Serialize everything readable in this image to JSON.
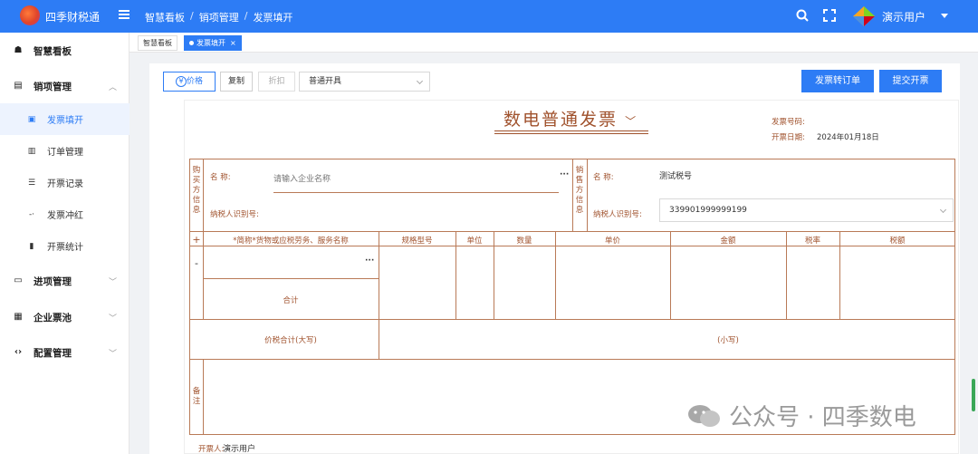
{
  "app": {
    "name": "四季财税通"
  },
  "breadcrumb": [
    "智慧看板",
    "销项管理",
    "发票填开"
  ],
  "user": {
    "name": "演示用户"
  },
  "sidebar": {
    "items": [
      {
        "label": "智慧看板",
        "icon": "dashboard-icon"
      },
      {
        "label": "销项管理",
        "icon": "document-icon",
        "expanded": true
      },
      {
        "label": "进项管理",
        "icon": "inbox-icon"
      },
      {
        "label": "企业票池",
        "icon": "card-icon"
      },
      {
        "label": "配置管理",
        "icon": "code-icon"
      }
    ],
    "sub_items": [
      {
        "label": "发票填开",
        "active": true
      },
      {
        "label": "订单管理"
      },
      {
        "label": "开票记录"
      },
      {
        "label": "发票冲红"
      },
      {
        "label": "开票统计"
      }
    ]
  },
  "tabs": [
    {
      "label": "智慧看板",
      "active": false
    },
    {
      "label": "发票填开",
      "active": true,
      "close": "×"
    }
  ],
  "toolbar": {
    "price_label": "价格",
    "price_symbol": "¥",
    "copy_label": "复制",
    "discount_label": "折扣",
    "invoice_type": "普通开具",
    "to_order_label": "发票转订单",
    "submit_label": "提交开票"
  },
  "invoice": {
    "title": "数电普通发票",
    "number_label": "发票号码:",
    "date_label": "开票日期:",
    "date_value": "2024年01月18日",
    "buyer_section": "购买方信息",
    "seller_section": "销售方信息",
    "name_label": "名 称:",
    "buyer_name_placeholder": "请输入企业名称",
    "tax_id_label": "纳税人识别号:",
    "seller_name": "测试税号",
    "seller_tax_id": "339901999999199",
    "columns": [
      "*简称*货物或应税劳务、服务名称",
      "规格型号",
      "单位",
      "数量",
      "单价",
      "金额",
      "税率",
      "税额"
    ],
    "add_row": "+",
    "remove_row": "-",
    "more": "···",
    "subtotal_label": "合计",
    "total_caps_label": "价税合计(大写)",
    "total_small_label": "(小写)",
    "remark_label": "备注",
    "issuer_label": "开票人:",
    "issuer_value": "演示用户"
  },
  "watermark": {
    "text": "公众号 · 四季数电"
  },
  "colors": {
    "primary": "#2d7cf5",
    "invoice_brown": "#a0522d"
  }
}
